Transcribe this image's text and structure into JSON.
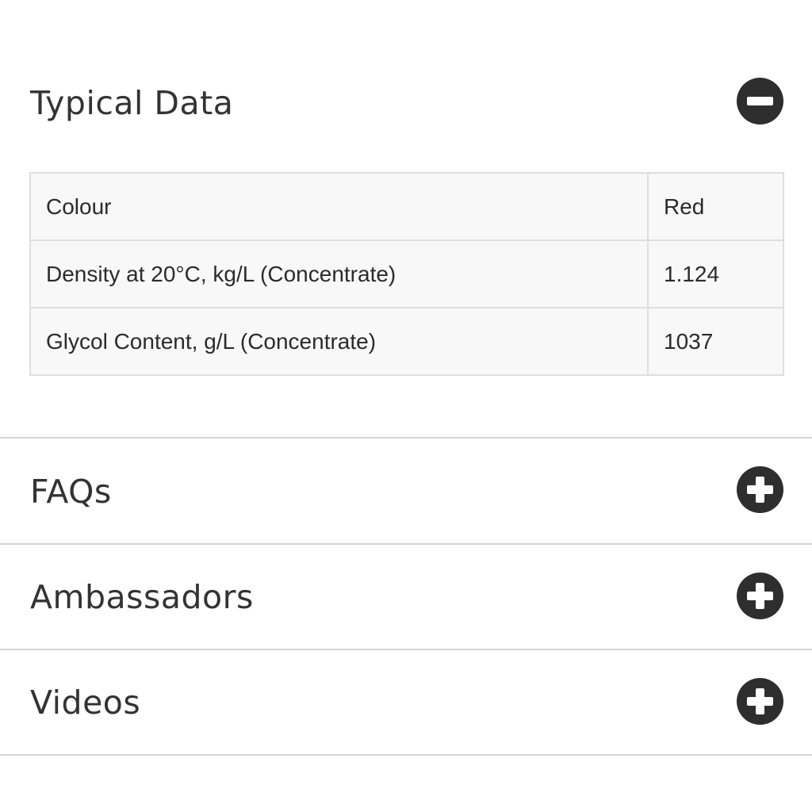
{
  "typical_data": {
    "title": "Typical Data",
    "toggle_icon": "minus-circle-icon",
    "rows": [
      {
        "property": "Colour",
        "value": "Red"
      },
      {
        "property": "Density at 20°C, kg/L (Concentrate)",
        "value": "1.124"
      },
      {
        "property": "Glycol Content, g/L (Concentrate)",
        "value": "1037"
      }
    ]
  },
  "sections": [
    {
      "title": "FAQs",
      "toggle_icon": "plus-circle-icon"
    },
    {
      "title": "Ambassadors",
      "toggle_icon": "plus-circle-icon"
    },
    {
      "title": "Videos",
      "toggle_icon": "plus-circle-icon"
    }
  ],
  "colors": {
    "icon": "#2e2e2e",
    "divider": "#d4d4d4",
    "table_bg": "#f8f8f8",
    "table_border": "#dedede"
  }
}
